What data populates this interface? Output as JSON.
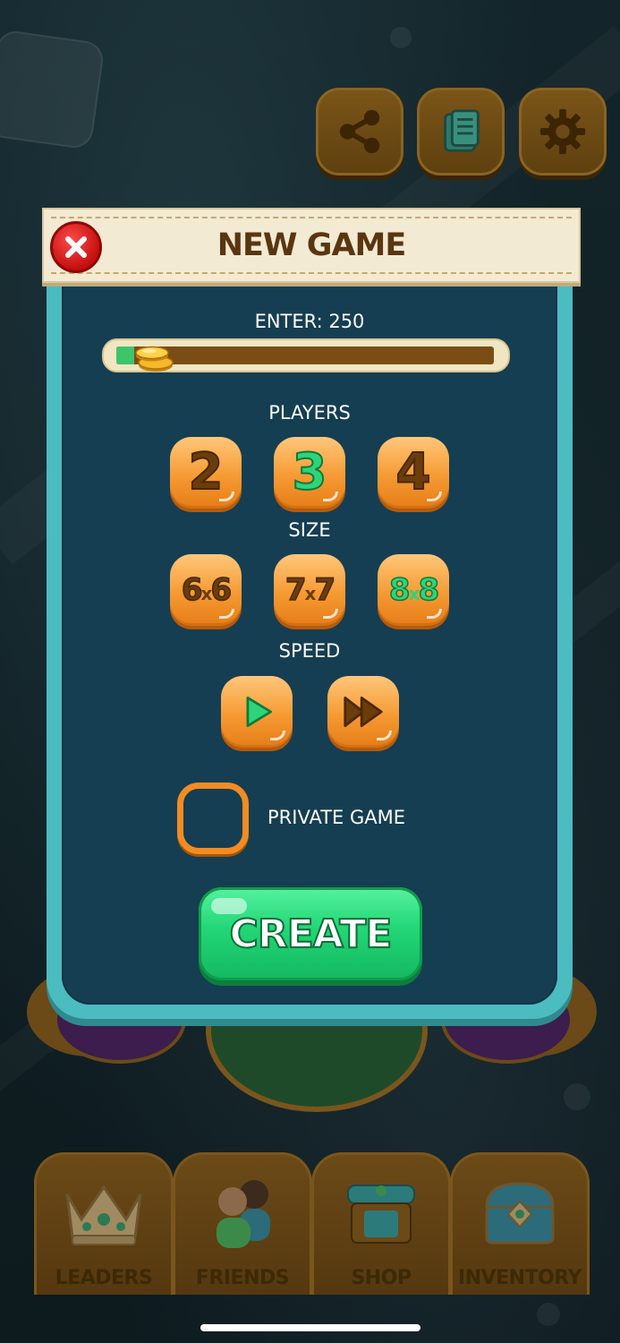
{
  "header_buttons": {
    "share_icon": "share-icon",
    "news_icon": "news-icon",
    "settings_icon": "gear-icon"
  },
  "modal": {
    "title": "NEW GAME",
    "close_icon": "close-icon",
    "entry": {
      "label": "ENTER: 250",
      "slider_fraction": 0.08
    },
    "players": {
      "label": "PLAYERS",
      "options": [
        "2",
        "3",
        "4"
      ],
      "selected": "3"
    },
    "size": {
      "label": "SIZE",
      "options": [
        {
          "a": "6",
          "x": "x",
          "b": "6"
        },
        {
          "a": "7",
          "x": "x",
          "b": "7"
        },
        {
          "a": "8",
          "x": "x",
          "b": "8"
        }
      ],
      "selected_index": 2
    },
    "speed": {
      "label": "SPEED",
      "options": [
        "play-icon",
        "fast-forward-icon"
      ],
      "selected_index": 0
    },
    "private_game": {
      "label": "PRIVATE GAME",
      "checked": false
    },
    "create_label": "CREATE"
  },
  "bottom_nav": {
    "items": [
      {
        "label": "LEADERS",
        "icon": "crown-icon"
      },
      {
        "label": "FRIENDS",
        "icon": "friends-icon"
      },
      {
        "label": "SHOP",
        "icon": "shop-icon"
      },
      {
        "label": "INVENTORY",
        "icon": "chest-icon"
      }
    ]
  },
  "colors": {
    "panel_blue": "#153e52",
    "panel_border": "#4bbcbf",
    "orange": "#f69a33",
    "selected_green": "#2ed47a",
    "create_green": "#22d676"
  }
}
